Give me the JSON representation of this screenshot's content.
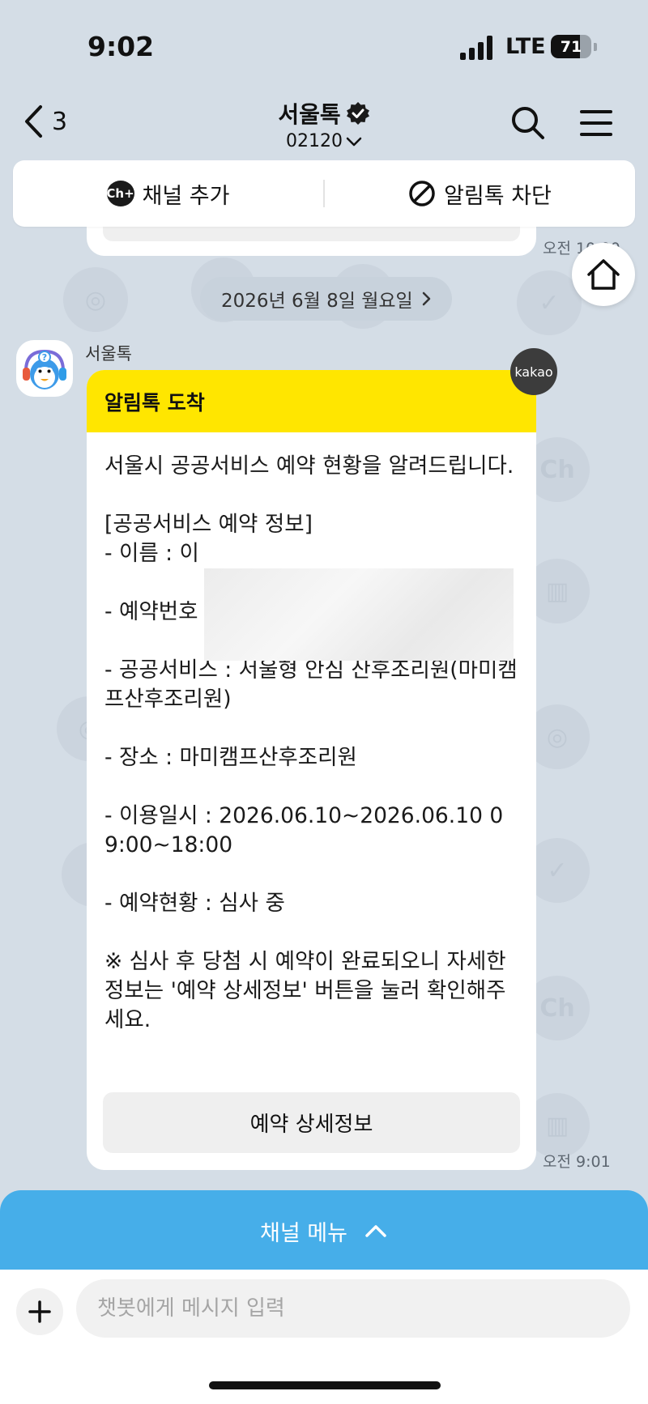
{
  "status_bar": {
    "time": "9:02",
    "network": "LTE",
    "battery": "71",
    "battery_level_pct": 71
  },
  "header": {
    "back_count": "3",
    "title": "서울톡",
    "channel_id": "02120",
    "icons": {
      "back": "chevron-left-icon",
      "verified": "verified-badge-icon",
      "search": "search-icon",
      "menu": "hamburger-menu-icon",
      "dropdown": "chevron-down-icon"
    }
  },
  "action_bar": {
    "add_channel_icon": "Ch+",
    "add_channel_label": "채널 추가",
    "block_label": "알림톡 차단"
  },
  "prior_message": {
    "time": "오전 10:00"
  },
  "date_divider": "2026년 6월 8일 월요일",
  "message": {
    "sender": "서울톡",
    "badge": "kakao",
    "header": "알림톡 도착",
    "body": "서울시 공공서비스 예약 현황을 알려드립니다.\n\n[공공서비스 예약 정보]\n- 이름 : 이\n\n- 예약번호\n\n- 공공서비스 : 서울형 안심 산후조리원(마미캠프산후조리원)\n\n- 장소 : 마미캠프산후조리원\n\n- 이용일시 : 2026.06.10~2026.06.10 09:00~18:00\n\n- 예약현황 : 심사 중\n\n※ 심사 후 당첨 시 예약이 완료되오니 자세한 정보는 '예약 상세정보' 버튼을 눌러 확인해주세요.",
    "button_label": "예약 상세정보",
    "time": "오전 9:01"
  },
  "channel_menu": {
    "label": "채널 메뉴"
  },
  "input": {
    "placeholder": "챗봇에게 메시지 입력"
  },
  "colors": {
    "background": "#d4dde6",
    "header_yellow": "#ffe600",
    "channel_menu_blue": "#46aee9"
  }
}
